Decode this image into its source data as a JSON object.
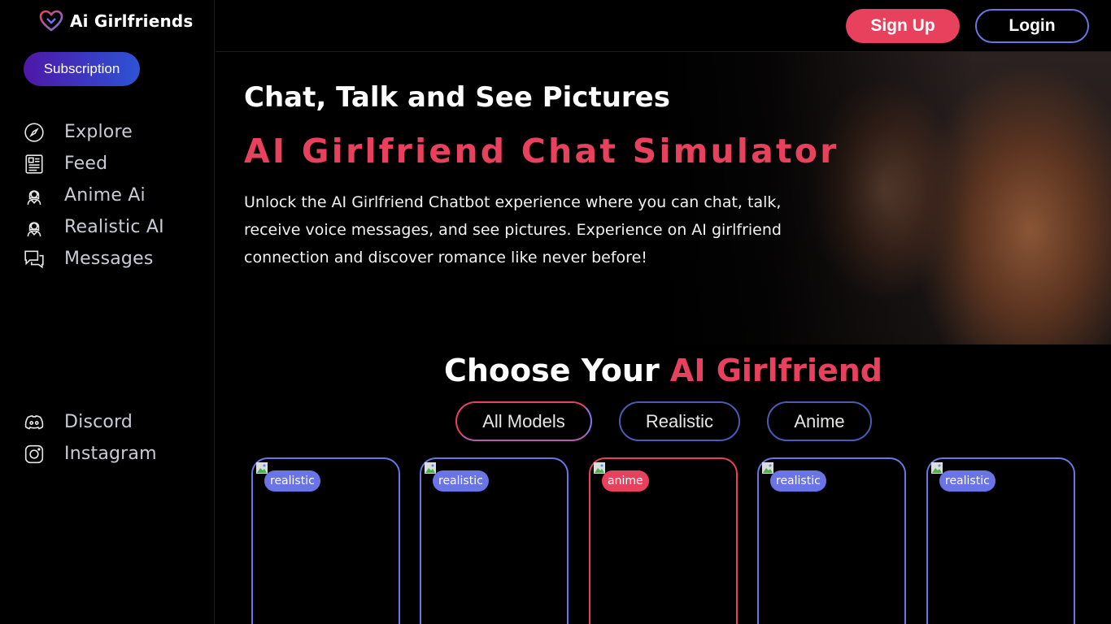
{
  "brand": {
    "name": "Ai Girlfriends"
  },
  "sidebar": {
    "subscription_label": "Subscription",
    "nav": [
      {
        "label": "Explore",
        "icon": "compass-icon"
      },
      {
        "label": "Feed",
        "icon": "newspaper-icon"
      },
      {
        "label": "Anime Ai",
        "icon": "woman-avatar-icon"
      },
      {
        "label": "Realistic AI",
        "icon": "woman-avatar-icon"
      },
      {
        "label": "Messages",
        "icon": "chat-bubbles-icon"
      }
    ],
    "social": [
      {
        "label": "Discord",
        "icon": "discord-icon"
      },
      {
        "label": "Instagram",
        "icon": "instagram-icon"
      }
    ]
  },
  "header": {
    "signup_label": "Sign Up",
    "login_label": "Login"
  },
  "hero": {
    "subtitle": "Chat, Talk and See Pictures",
    "title": "AI Girlfriend Chat Simulator",
    "description": "Unlock the AI Girlfriend Chatbot experience where you can chat, talk, receive voice messages, and see pictures. Experience on AI girlfriend connection and discover romance like never before!"
  },
  "choose": {
    "prefix": "Choose Your ",
    "accent": "AI Girlfriend"
  },
  "filters": [
    "All Models",
    "Realistic",
    "Anime"
  ],
  "cards": [
    {
      "tag": "realistic"
    },
    {
      "tag": "realistic"
    },
    {
      "tag": "anime"
    },
    {
      "tag": "realistic"
    },
    {
      "tag": "realistic"
    }
  ],
  "colors": {
    "accent": "#e8415d",
    "brand_blue": "#6b74e6",
    "background": "#000000"
  }
}
